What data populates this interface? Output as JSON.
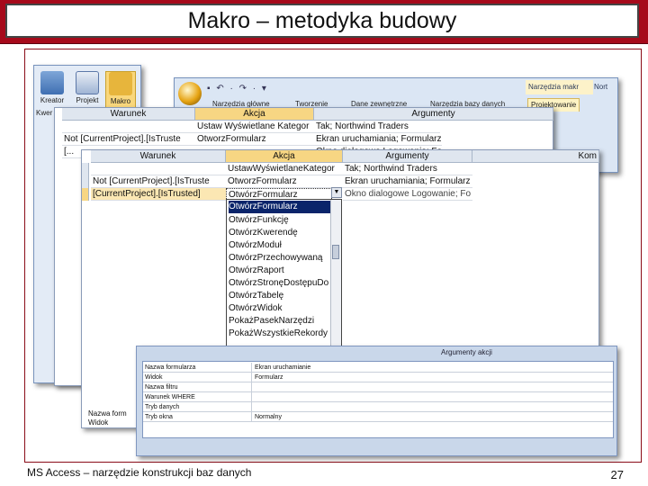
{
  "slide": {
    "title": "Makro – metodyka budowy",
    "footer": "MS Access – narzędzie konstrukcji baz danych",
    "page_number": "27"
  },
  "ribbon_buttons": {
    "kreator_label": "Kreator",
    "kreator_sub": "Kwer",
    "projekt_label": "Projekt",
    "makro_label": "Makro"
  },
  "office_ribbon": {
    "contextual_tab": "Narzędzia makr",
    "contextual_tab_2": "Nort",
    "tabs": [
      "Narzędzia główne",
      "Tworzenie",
      "Dane zewnętrzne",
      "Narzędzia bazy danych",
      "Projektowanie"
    ]
  },
  "grid_back": {
    "headers": [
      "Warunek",
      "Akcja",
      "Argumenty"
    ],
    "rows": [
      [
        "",
        "Ustaw Wyświetlane Kategor",
        "Tak; Northwind Traders"
      ],
      [
        "Not [CurrentProject].[IsTruste",
        "OtworzFormularz",
        "Ekran uruchamiania; Formularz"
      ],
      [
        "[...",
        "",
        "Okno dialogowe Logowanie; Formularz"
      ]
    ]
  },
  "grid_front": {
    "headers": [
      "Warunek",
      "Akcja",
      "Argumenty",
      "Kom"
    ],
    "rows": [
      [
        "",
        "UstawWyświetlaneKategor",
        "Tak; Northwind Traders"
      ],
      [
        "Not [CurrentProject].[IsTruste",
        "OtworzFormularz",
        "Ekran uruchamiania; Formularz"
      ],
      [
        "[CurrentProject].[IsTrusted]",
        "OtwórzFormularz",
        "Okno dialogowe Logowanie; Fo"
      ]
    ]
  },
  "action_dropdown": {
    "items": [
      "OtwórzFormularz",
      "OtwórzFunkcję",
      "OtwórzKwerendę",
      "OtwórzModuł",
      "OtwórzPrzechowywaną",
      "OtwórzRaport",
      "OtwórzStronęDostępuDo",
      "OtwórzTabelę",
      "OtwórzWidok",
      "PokażPasekNarzędzi",
      "PokażWszystkieRekordy"
    ],
    "highlighted_index": 0
  },
  "action_args": {
    "title": "Argumenty akcji",
    "rows": [
      {
        "name": "Nazwa formularza",
        "value": "Ekran uruchamianie"
      },
      {
        "name": "Widok",
        "value": "Formularz"
      },
      {
        "name": "Nazwa filtru",
        "value": ""
      },
      {
        "name": "Warunek WHERE",
        "value": ""
      },
      {
        "name": "Tryb danych",
        "value": ""
      },
      {
        "name": "Tryb okna",
        "value": "Normalny"
      }
    ],
    "behind_rows": [
      "Nazwa form",
      "Widok"
    ]
  },
  "colors": {
    "title_bar": "#a60a1b",
    "selection": "#f7d683",
    "highlight": "#0a246a"
  }
}
